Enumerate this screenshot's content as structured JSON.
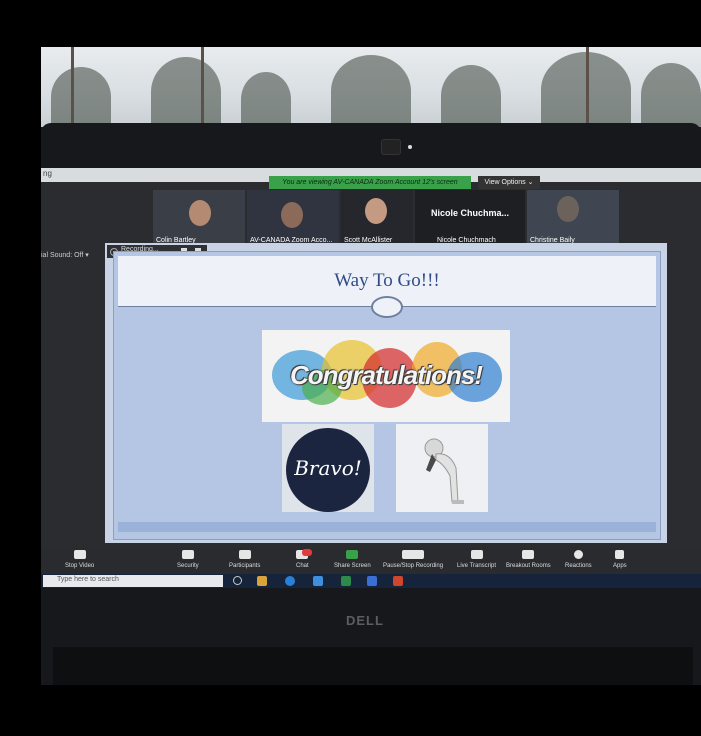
{
  "zoom": {
    "top_bar_text": "ng",
    "viewing_banner": "You are viewing AV-CANADA Zoom Account 12's screen",
    "view_options": "View Options ⌄",
    "left_label": "ial Sound: Off  ▾",
    "participants": [
      {
        "name": "Colin Bartley"
      },
      {
        "name": "AV-CANADA Zoom Acco..."
      },
      {
        "name": "Scott McAllister"
      },
      {
        "name": "Nicole Chuchmach",
        "display_name": "Nicole Chuchma..."
      },
      {
        "name": "Christine Baily"
      }
    ],
    "recording_label": "Recording..."
  },
  "slide": {
    "title": "Way To Go!!!",
    "congrats_text": "Congratulations!",
    "bravo_text": "Bravo!"
  },
  "toolbar": {
    "items": [
      {
        "label": "Stop Video",
        "icon": "video-icon"
      },
      {
        "label": "Security",
        "icon": "shield-icon"
      },
      {
        "label": "Participants",
        "icon": "people-icon",
        "count": "5"
      },
      {
        "label": "Chat",
        "icon": "chat-icon"
      },
      {
        "label": "Share Screen",
        "icon": "share-icon"
      },
      {
        "label": "Pause/Stop Recording",
        "icon": "pause-icon"
      },
      {
        "label": "Live Transcript",
        "icon": "cc-icon"
      },
      {
        "label": "Breakout Rooms",
        "icon": "grid-icon"
      },
      {
        "label": "Reactions",
        "icon": "smile-icon"
      },
      {
        "label": "Apps",
        "icon": "apps-icon"
      }
    ]
  },
  "taskbar": {
    "search_placeholder": "Type here to search"
  },
  "laptop": {
    "brand": "DELL"
  },
  "colors": {
    "banner_green": "#3aa14b",
    "slide_blue": "#b5c6e4",
    "title_blue": "#2f4a86",
    "bravo_navy": "#1c2540"
  }
}
